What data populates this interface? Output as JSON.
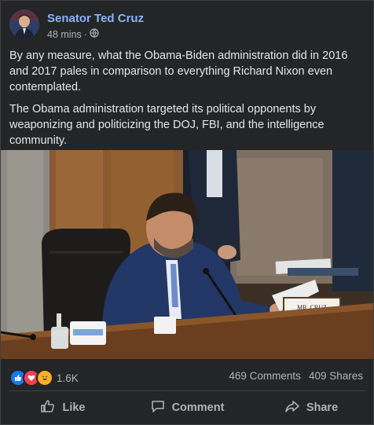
{
  "post": {
    "author": "Senator Ted Cruz",
    "time": "48 mins",
    "separator": "·",
    "privacy_icon": "globe-icon",
    "paragraphs": [
      "By any measure, what the Obama-Biden administration did in 2016 and 2017 pales in comparison to everything Richard Nixon even contemplated.",
      "The Obama administration targeted its political opponents by weaponizing and politicizing the DOJ, FBI, and the intelligence community."
    ],
    "image_nameplate": "MR. CRUZ"
  },
  "stats": {
    "reaction_icons": [
      "like-icon",
      "love-icon",
      "haha-icon"
    ],
    "reaction_count": "1.6K",
    "comments": "469 Comments",
    "shares": "409 Shares"
  },
  "actions": {
    "like": "Like",
    "comment": "Comment",
    "share": "Share"
  },
  "colors": {
    "background": "#242526",
    "author_link": "#8ab4f8",
    "text": "#e4e6eb",
    "muted": "#b0b3b8",
    "like_blue": "#1877f2",
    "love_red": "#f33e58",
    "haha_yellow": "#f7b125"
  }
}
